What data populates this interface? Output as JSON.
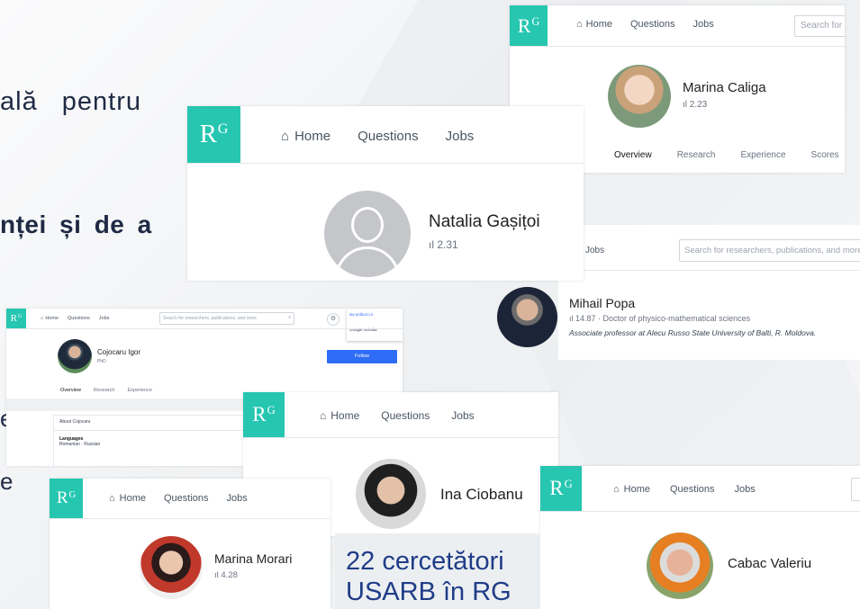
{
  "slide": {
    "line1": "ală pentru",
    "line2": "nței și de a",
    "frag1": "e",
    "frag2": "e",
    "caption_line1": "22 cercetători",
    "caption_line2": "USARB în RG"
  },
  "common": {
    "logo": "R",
    "logo_sup": "G",
    "home": "Home",
    "questions": "Questions",
    "jobs": "Jobs"
  },
  "cards": {
    "caliga": {
      "search": "Search for",
      "name": "Marina Caliga",
      "score": "2.23",
      "tabs": [
        "Overview",
        "Research",
        "Experience",
        "Scores"
      ]
    },
    "gasitoi": {
      "name": "Natalia Gașițoi",
      "score": "2.31"
    },
    "popa": {
      "jobs": "Jobs",
      "search": "Search for researchers, publications, and more",
      "name": "Mihail Popa",
      "score_line": "14.87 · Doctor of physico-mathematical sciences",
      "position": "Associate professor at Alecu Russo State University of Balti, R. Moldova."
    },
    "cojocaru": {
      "search": "Search for researchers, publications, and more",
      "name": "Cojocaru Igor",
      "degree": "PhD",
      "tabs": [
        "Overview",
        "Research",
        "Experience"
      ],
      "follow": "Follow",
      "about": "About Cojocaru",
      "languages_label": "Languages",
      "languages": "Romanian · Russian",
      "popup_item1": "iav.unibuci.ro",
      "popup_item2": "Google Scholar"
    },
    "ciobanu": {
      "name": "Ina Ciobanu"
    },
    "morari": {
      "name": "Marina Morari",
      "score": "4.28"
    },
    "cabac": {
      "name": "Cabac Valeriu"
    }
  },
  "colors": {
    "logo": "#26c6b0",
    "caption_text": "#1f3c88",
    "slide_text": "#1f2a44",
    "follow": "#2f6df6"
  }
}
